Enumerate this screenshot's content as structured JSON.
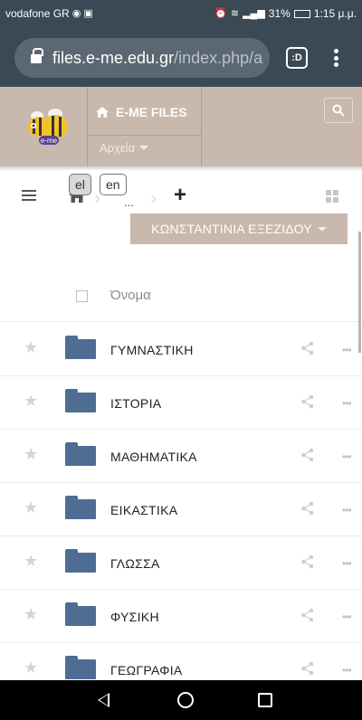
{
  "status": {
    "carrier": "vodafone GR",
    "battery": "31%",
    "battery_level": 0.31,
    "time": "1:15 μ.μ."
  },
  "browser": {
    "url_host": "files.e-me.edu.gr",
    "url_path": "/index.php/a",
    "tabs_label": ":D"
  },
  "header": {
    "logo_text": "e-me",
    "title": "E-ME FILES",
    "folder_menu": "Αρχεία"
  },
  "toolbar": {
    "lang_el": "el",
    "lang_en": "en",
    "breadcrumb_more": "...",
    "add_label": "+"
  },
  "user": {
    "name": "ΚΩΝΣΤΑΝΤΙΝΙΑ ΕΞΕΖΙΔΟΥ"
  },
  "list": {
    "header_name": "Όνομα",
    "rows": [
      {
        "name": "ΓΥΜΝΑΣΤΙΚΗ"
      },
      {
        "name": "ΙΣΤΟΡΙΑ"
      },
      {
        "name": "ΜΑΘΗΜΑΤΙΚΑ"
      },
      {
        "name": "ΕΙΚΑΣΤΙΚΑ"
      },
      {
        "name": "ΓΛΩΣΣΑ"
      },
      {
        "name": "ΦΥΣΙΚΗ"
      },
      {
        "name": "ΓΕΩΓΡΑΦΙΑ"
      }
    ],
    "more_glyph": "•••",
    "star_glyph": "★"
  },
  "colors": {
    "header_bg": "#c9b8ad",
    "browser_bg": "#3a4954",
    "folder": "#4f6c93"
  }
}
